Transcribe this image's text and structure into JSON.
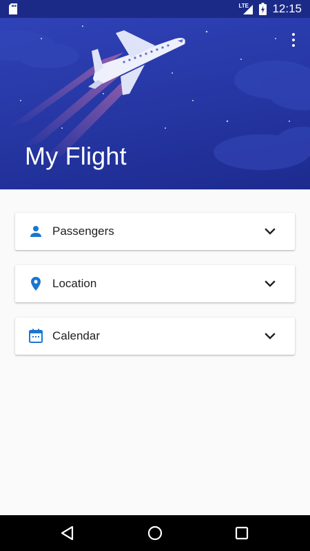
{
  "status_bar": {
    "network": "LTE",
    "time": "12:15",
    "icons": [
      "sd-card-icon",
      "lte-signal-icon",
      "battery-charging-icon"
    ]
  },
  "header": {
    "title": "My Flight",
    "menu_icon": "more-vert-icon",
    "colors": {
      "background": "#2a3aa8",
      "title": "#ffffff"
    }
  },
  "sections": [
    {
      "label": "Passengers",
      "icon": "person-icon",
      "expand_icon": "chevron-down-icon"
    },
    {
      "label": "Location",
      "icon": "location-pin-icon",
      "expand_icon": "chevron-down-icon"
    },
    {
      "label": "Calendar",
      "icon": "calendar-icon",
      "expand_icon": "chevron-down-icon"
    }
  ],
  "accent_color": "#1976d2",
  "navigation": {
    "back_icon": "back-triangle-icon",
    "home_icon": "home-circle-icon",
    "recents_icon": "recents-square-icon"
  }
}
